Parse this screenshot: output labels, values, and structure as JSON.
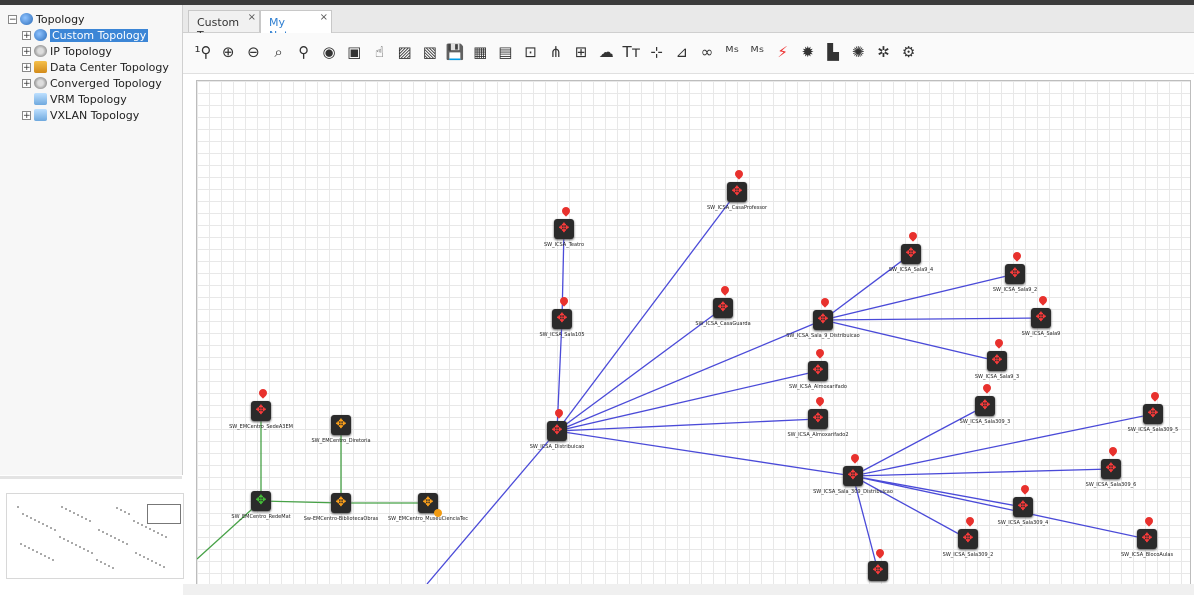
{
  "tree": {
    "items": [
      {
        "label": "Topology",
        "expander": "−",
        "icon": "globe-icon",
        "selected": false
      },
      {
        "label": "Custom Topology",
        "expander": "+",
        "icon": "world-icon",
        "selected": true
      },
      {
        "label": "IP Topology",
        "expander": "+",
        "icon": "gear-icon",
        "selected": false
      },
      {
        "label": "Data Center Topology",
        "expander": "+",
        "icon": "datacenter-icon",
        "selected": false
      },
      {
        "label": "Converged Topology",
        "expander": "+",
        "icon": "gear-icon",
        "selected": false
      },
      {
        "label": "VRM Topology",
        "expander": "",
        "icon": "layers-icon",
        "selected": false
      },
      {
        "label": "VXLAN Topology",
        "expander": "+",
        "icon": "layers-icon",
        "selected": false
      }
    ]
  },
  "tabs": [
    {
      "label": "Custom To...",
      "close": "×",
      "active": false
    },
    {
      "label": "My Networ...",
      "close": "×",
      "active": true
    }
  ],
  "toolbar": {
    "buttons": [
      {
        "name": "zoom-reset-icon",
        "glyph": "¹⚲"
      },
      {
        "name": "zoom-in-icon",
        "glyph": "⊕"
      },
      {
        "name": "zoom-out-icon",
        "glyph": "⊖"
      },
      {
        "name": "zoom-fit-icon",
        "glyph": "⌕"
      },
      {
        "name": "search-icon",
        "glyph": "⚲"
      },
      {
        "name": "eye-icon",
        "glyph": "◉"
      },
      {
        "name": "select-icon",
        "glyph": "▣"
      },
      {
        "name": "hand-icon",
        "glyph": "☝"
      },
      {
        "name": "layout-icon",
        "glyph": "▨"
      },
      {
        "name": "layout-disabled-icon",
        "glyph": "▧"
      },
      {
        "name": "save-icon",
        "glyph": "💾"
      },
      {
        "name": "image-icon",
        "glyph": "▦"
      },
      {
        "name": "export-icon",
        "glyph": "▤"
      },
      {
        "name": "frame-icon",
        "glyph": "⊡"
      },
      {
        "name": "tree-icon",
        "glyph": "⋔"
      },
      {
        "name": "add-device-icon",
        "glyph": "⊞"
      },
      {
        "name": "cloud-add-icon",
        "glyph": "☁"
      },
      {
        "name": "text-icon",
        "glyph": "Tт"
      },
      {
        "name": "add-link-icon",
        "glyph": "⊹"
      },
      {
        "name": "remove-link-icon",
        "glyph": "⊿"
      },
      {
        "name": "binoculars-icon",
        "glyph": "∞"
      },
      {
        "name": "ms-trace-icon",
        "glyph": "ᴹˢ"
      },
      {
        "name": "ms-config-icon",
        "glyph": "ᴹˢ"
      },
      {
        "name": "lightning-icon",
        "glyph": "⚡"
      },
      {
        "name": "settings-icon",
        "glyph": "✹"
      },
      {
        "name": "vlan-icon",
        "glyph": "▙"
      },
      {
        "name": "health-icon",
        "glyph": "✺"
      },
      {
        "name": "config-icon",
        "glyph": "✲"
      },
      {
        "name": "gears-icon",
        "glyph": "⚙"
      }
    ]
  },
  "nodes": [
    {
      "id": "SW_ICSA_CasaProfessor",
      "label": "SW_ICSA_CasaProfessor",
      "status": "critical",
      "color": "red"
    },
    {
      "id": "SW_ICSA_Teatro",
      "label": "SW_ICSA_Teatro",
      "status": "critical",
      "color": "red"
    },
    {
      "id": "SW_ICSA_Sala9_4",
      "label": "SW_ICSA_Sala9_4",
      "status": "critical",
      "color": "red"
    },
    {
      "id": "SW_ICSA_Sala9_2",
      "label": "SW_ICSA_Sala9_2",
      "status": "critical",
      "color": "red"
    },
    {
      "id": "SW_ICSA_CasaGuarda",
      "label": "SW_ICSA_CasaGuarda",
      "status": "critical",
      "color": "red"
    },
    {
      "id": "SW_ICSA_Sala105",
      "label": "SW_ICSA_Sala105",
      "status": "critical",
      "color": "red"
    },
    {
      "id": "SW_ICSA_Sala_9_Distribuicao",
      "label": "SW_ICSA_Sala_9_Distribuicao",
      "status": "critical",
      "color": "red"
    },
    {
      "id": "SW_ICSA_Sala9",
      "label": "SW_ICSA_Sala9",
      "status": "critical",
      "color": "red"
    },
    {
      "id": "SW_ICSA_Sala9_3",
      "label": "SW_ICSA_Sala9_3",
      "status": "critical",
      "color": "red"
    },
    {
      "id": "SW_ICSA_AlmoxarifadoA",
      "label": "SW_ICSA_Almoxarifado",
      "status": "critical",
      "color": "red"
    },
    {
      "id": "SW_ICSA_Sala309_3",
      "label": "SW_ICSA_Sala309_3",
      "status": "critical",
      "color": "red"
    },
    {
      "id": "SW_ICSA_Sala309_5",
      "label": "SW_ICSA_Sala309_5",
      "status": "critical",
      "color": "red"
    },
    {
      "id": "SW_ICSA_AlmoxarifadoB",
      "label": "SW_ICSA_Almoxarifado2",
      "status": "critical",
      "color": "red"
    },
    {
      "id": "SW_ICSA_Distribuicao",
      "label": "SW_ICSA_Distribuicao",
      "status": "critical",
      "color": "red"
    },
    {
      "id": "SW_EMCentro_SedeA3EM",
      "label": "SW_EMCentro_SedeA3EM",
      "status": "critical",
      "color": "red"
    },
    {
      "id": "SW_EMCentro_Diretoria",
      "label": "SW_EMCentro_Diretoria",
      "status": "warning",
      "color": "orange"
    },
    {
      "id": "SW_ICSA_Sala_309_Distribuicao",
      "label": "SW_ICSA_Sala_309_Distribuicao",
      "status": "critical",
      "color": "red"
    },
    {
      "id": "SW_ICSA_Sala309_6",
      "label": "SW_ICSA_Sala309_6",
      "status": "critical",
      "color": "red"
    },
    {
      "id": "SW_ICSA_Sala309_4",
      "label": "SW_ICSA_Sala309_4",
      "status": "critical",
      "color": "red"
    },
    {
      "id": "SW_EMCentro_RedeMat",
      "label": "SW_EMCentro_RedeMat",
      "status": "ok",
      "color": "green"
    },
    {
      "id": "Sw-EMCentro-BibliotecaObras",
      "label": "Sw-EMCentro-BibliotecaObras",
      "status": "warning",
      "color": "orange"
    },
    {
      "id": "SW_EMCentro_MuseuCienciaTec",
      "label": "SW_EMCentro_MuseuCienciaTec",
      "status": "warning",
      "color": "orange"
    },
    {
      "id": "SW_ICSA_Sala309_2",
      "label": "SW_ICSA_Sala309_2",
      "status": "critical",
      "color": "red"
    },
    {
      "id": "SW_ICSA_BlocoAulas",
      "label": "SW_ICSA_BlocoAulas",
      "status": "critical",
      "color": "red"
    },
    {
      "id": "SWPoE_ICSA",
      "label": "SWPoE_ICSA",
      "status": "critical",
      "color": "red"
    }
  ],
  "links": [
    [
      "SW_ICSA_Distribuicao",
      "SW_ICSA_CasaProfessor"
    ],
    [
      "SW_ICSA_Distribuicao",
      "SW_ICSA_Sala105"
    ],
    [
      "SW_ICSA_Sala105",
      "SW_ICSA_Teatro"
    ],
    [
      "SW_ICSA_Distribuicao",
      "SW_ICSA_CasaGuarda"
    ],
    [
      "SW_ICSA_Distribuicao",
      "SW_ICSA_Sala_9_Distribuicao"
    ],
    [
      "SW_ICSA_Distribuicao",
      "SW_ICSA_AlmoxarifadoA"
    ],
    [
      "SW_ICSA_Distribuicao",
      "SW_ICSA_AlmoxarifadoB"
    ],
    [
      "SW_ICSA_Distribuicao",
      "SW_ICSA_Sala_309_Distribuicao"
    ],
    [
      "SW_ICSA_Sala_9_Distribuicao",
      "SW_ICSA_Sala9_4"
    ],
    [
      "SW_ICSA_Sala_9_Distribuicao",
      "SW_ICSA_Sala9_2"
    ],
    [
      "SW_ICSA_Sala_9_Distribuicao",
      "SW_ICSA_Sala9"
    ],
    [
      "SW_ICSA_Sala_9_Distribuicao",
      "SW_ICSA_Sala9_3"
    ],
    [
      "SW_ICSA_Sala_309_Distribuicao",
      "SW_ICSA_Sala309_3"
    ],
    [
      "SW_ICSA_Sala_309_Distribuicao",
      "SW_ICSA_Sala309_5"
    ],
    [
      "SW_ICSA_Sala_309_Distribuicao",
      "SW_ICSA_Sala309_6"
    ],
    [
      "SW_ICSA_Sala_309_Distribuicao",
      "SW_ICSA_Sala309_4"
    ],
    [
      "SW_ICSA_Sala_309_Distribuicao",
      "SW_ICSA_Sala309_2"
    ],
    [
      "SW_ICSA_Sala_309_Distribuicao",
      "SW_ICSA_BlocoAulas"
    ],
    [
      "SW_ICSA_Sala_309_Distribuicao",
      "SWPoE_ICSA"
    ],
    [
      "SW_EMCentro_SedeA3EM",
      "SW_EMCentro_RedeMat"
    ],
    [
      "SW_EMCentro_RedeMat",
      "Sw-EMCentro-BibliotecaObras"
    ],
    [
      "Sw-EMCentro-BibliotecaObras",
      "SW_EMCentro_MuseuCienciaTec"
    ],
    [
      "Sw-EMCentro-BibliotecaObras",
      "SW_EMCentro_Diretoria"
    ]
  ],
  "colors": {
    "link_blue": "#4a4ad8",
    "link_green": "#46a146",
    "status_red": "#e8312d",
    "status_orange": "#f19b12",
    "status_green": "#45c238",
    "tab_active": "#2f7fd1",
    "tree_selected": "#3c86d6"
  }
}
